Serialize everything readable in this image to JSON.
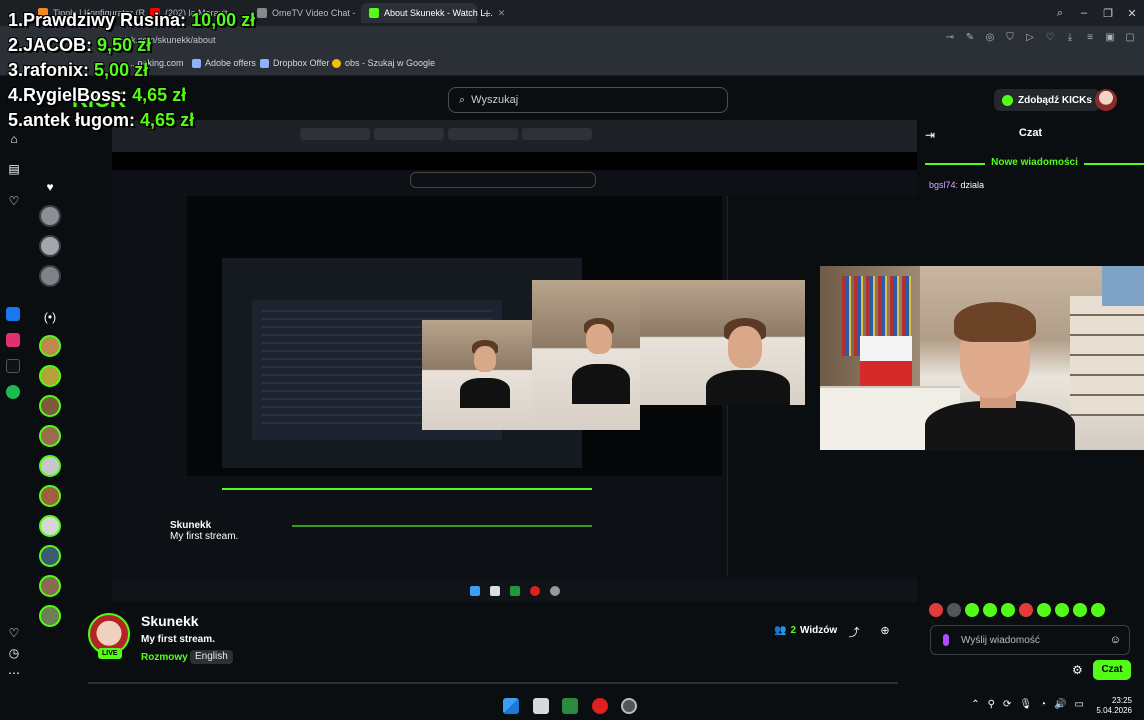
{
  "browser": {
    "tabs": [
      {
        "label": "Tipply | Konfigurator (R...",
        "active": false
      },
      {
        "label": "(202) la Moravit...",
        "active": false
      },
      {
        "label": "OmeTV Video Chat -",
        "active": false
      },
      {
        "label": "About Skunekk - Watch L...",
        "active": true
      }
    ],
    "url": "kick.com/skunekk/about",
    "bookmarks": [
      "...ooking.com",
      "Adobe offers",
      "Dropbox Offer",
      "obs - Szukaj w Google"
    ]
  },
  "leaderboard": [
    {
      "rank": "1.",
      "name": "Prawdziwy Rusina:",
      "amount": "10,00 zł"
    },
    {
      "rank": "2.",
      "name": "JACOB:",
      "amount": "9,50 zł"
    },
    {
      "rank": "3.",
      "name": "rafonix:",
      "amount": "5,00 zł"
    },
    {
      "rank": "4.",
      "name": "RygielBoss:",
      "amount": "4,65 zł"
    },
    {
      "rank": "5.",
      "name": "antek ługom:",
      "amount": "4,65 zł"
    }
  ],
  "kick": {
    "logo": "KICK",
    "search_placeholder": "Wyszukaj",
    "kicks_button": "Zdobądź KICKs"
  },
  "channel": {
    "name": "Skunekk",
    "live_badge": "LIVE",
    "stream_title": "My first stream.",
    "category": "Rozmowy",
    "tag": "English",
    "viewer_count": "2",
    "viewer_label": "Widzów"
  },
  "chat": {
    "title": "Czat",
    "new_messages": "Nowe wiadomości",
    "messages": [
      {
        "user": "bgsl74:",
        "text": "dziala"
      }
    ],
    "input_placeholder": "Wyślij wiadomość",
    "send_label": "Czat"
  },
  "taskbar": {
    "time": "23:25",
    "date": "5.04.2026"
  },
  "colors": {
    "accent": "#53fc18",
    "background": "#0b0e11"
  }
}
